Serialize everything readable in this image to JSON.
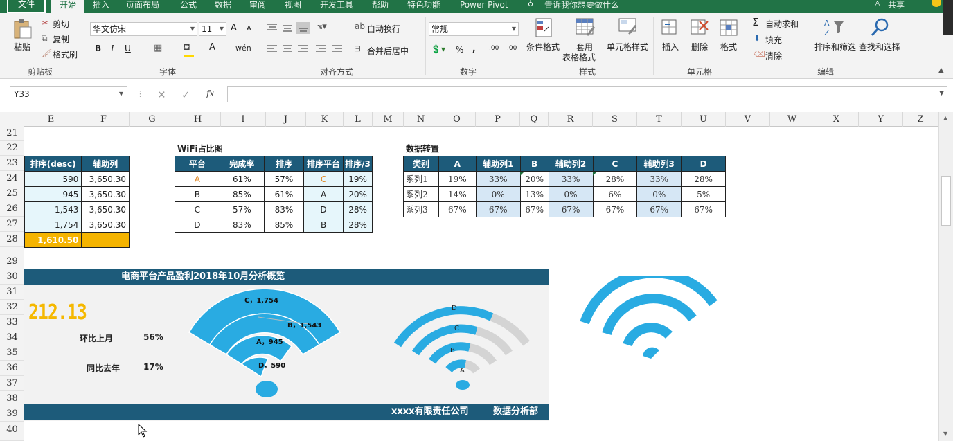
{
  "ribbon_tabs": [
    "文件",
    "开始",
    "插入",
    "页面布局",
    "公式",
    "数据",
    "审阅",
    "视图",
    "开发工具",
    "帮助",
    "特色功能",
    "Power Pivot",
    "告诉我你想要做什么",
    "共享"
  ],
  "clipboard": {
    "paste": "粘贴",
    "cut": "剪切",
    "copy": "复制",
    "format_painter": "格式刷",
    "label": "剪贴板"
  },
  "font": {
    "name": "华文仿宋",
    "size": "11",
    "label": "字体",
    "bold": "B",
    "italic": "I",
    "underline": "U",
    "grow": "A",
    "shrink": "A",
    "phonetic": "wén"
  },
  "alignment": {
    "wrap": "自动换行",
    "merge": "合并后居中",
    "label": "对齐方式"
  },
  "number": {
    "format": "常规",
    "label": "数字",
    "percent": "%",
    "comma": ",",
    "inc": ".00",
    "dec": ".00"
  },
  "styles": {
    "conditional": "条件格式",
    "table_line1": "套用",
    "table_line2": "表格格式",
    "cell_styles": "单元格样式",
    "label": "样式"
  },
  "cells": {
    "insert": "插入",
    "delete": "删除",
    "format": "格式",
    "label": "单元格"
  },
  "editing": {
    "autosum": "自动求和",
    "fill": "填充",
    "clear": "清除",
    "sort": "排序和筛选",
    "find": "查找和选择",
    "label": "编辑"
  },
  "formula_bar": {
    "name_box": "Y33",
    "fx": "fx",
    "cancel": "✕",
    "enter": "✓",
    "value": ""
  },
  "columns": [
    "E",
    "F",
    "G",
    "H",
    "I",
    "J",
    "K",
    "L",
    "M",
    "N",
    "O",
    "P",
    "Q",
    "R",
    "S",
    "T",
    "U",
    "V",
    "W",
    "X",
    "Y",
    "Z"
  ],
  "rows": [
    "21",
    "22",
    "23",
    "24",
    "25",
    "26",
    "27",
    "28",
    "29",
    "30",
    "31",
    "32",
    "33",
    "34",
    "35",
    "36",
    "37",
    "38",
    "39",
    "40"
  ],
  "sort_table": {
    "headers": [
      "排序(desc)",
      "辅助列"
    ],
    "rows": [
      [
        "590",
        "3,650.30"
      ],
      [
        "945",
        "3,650.30"
      ],
      [
        "1,543",
        "3,650.30"
      ],
      [
        "1,754",
        "3,650.30"
      ]
    ],
    "total": "1,610.50"
  },
  "wifi_table": {
    "title": "WiFi占比图",
    "headers": [
      "平台",
      "完成率",
      "排序",
      "排序平台",
      "排序/3"
    ],
    "rows": [
      [
        "A",
        "61%",
        "57%",
        "C",
        "19%"
      ],
      [
        "B",
        "85%",
        "61%",
        "A",
        "20%"
      ],
      [
        "C",
        "57%",
        "83%",
        "D",
        "28%"
      ],
      [
        "D",
        "83%",
        "85%",
        "B",
        "28%"
      ]
    ]
  },
  "transpose_table": {
    "title": "数据转置",
    "headers": [
      "类别",
      "A",
      "辅助列1",
      "B",
      "辅助列2",
      "C",
      "辅助列3",
      "D"
    ],
    "rows": [
      [
        "系列1",
        "19%",
        "33%",
        "20%",
        "33%",
        "28%",
        "33%",
        "28%"
      ],
      [
        "系列2",
        "14%",
        "0%",
        "13%",
        "0%",
        "6%",
        "0%",
        "5%"
      ],
      [
        "系列3",
        "67%",
        "67%",
        "67%",
        "67%",
        "67%",
        "67%",
        "67%"
      ]
    ]
  },
  "dashboard": {
    "title": "电商平台产品盈利2018年10月分析概览",
    "big_number": "212.13",
    "mom_label": "环比上月",
    "mom_value": "56%",
    "yoy_label": "同比去年",
    "yoy_value": "17%",
    "company": "xxxx有限责任公司",
    "dept": "数据分析部",
    "chart1_labels": [
      "C，1,754",
      "B，1,543",
      "A，945",
      "D，590"
    ],
    "chart2_labels": [
      "D",
      "C",
      "B",
      "A"
    ]
  },
  "colors": {
    "green": "#217346",
    "header_blue": "#1d5b7a",
    "wifi_blue": "#29abe2",
    "light_fill": "#e6f6fb",
    "gold": "#f5b800",
    "total_fill": "#f5b400"
  }
}
